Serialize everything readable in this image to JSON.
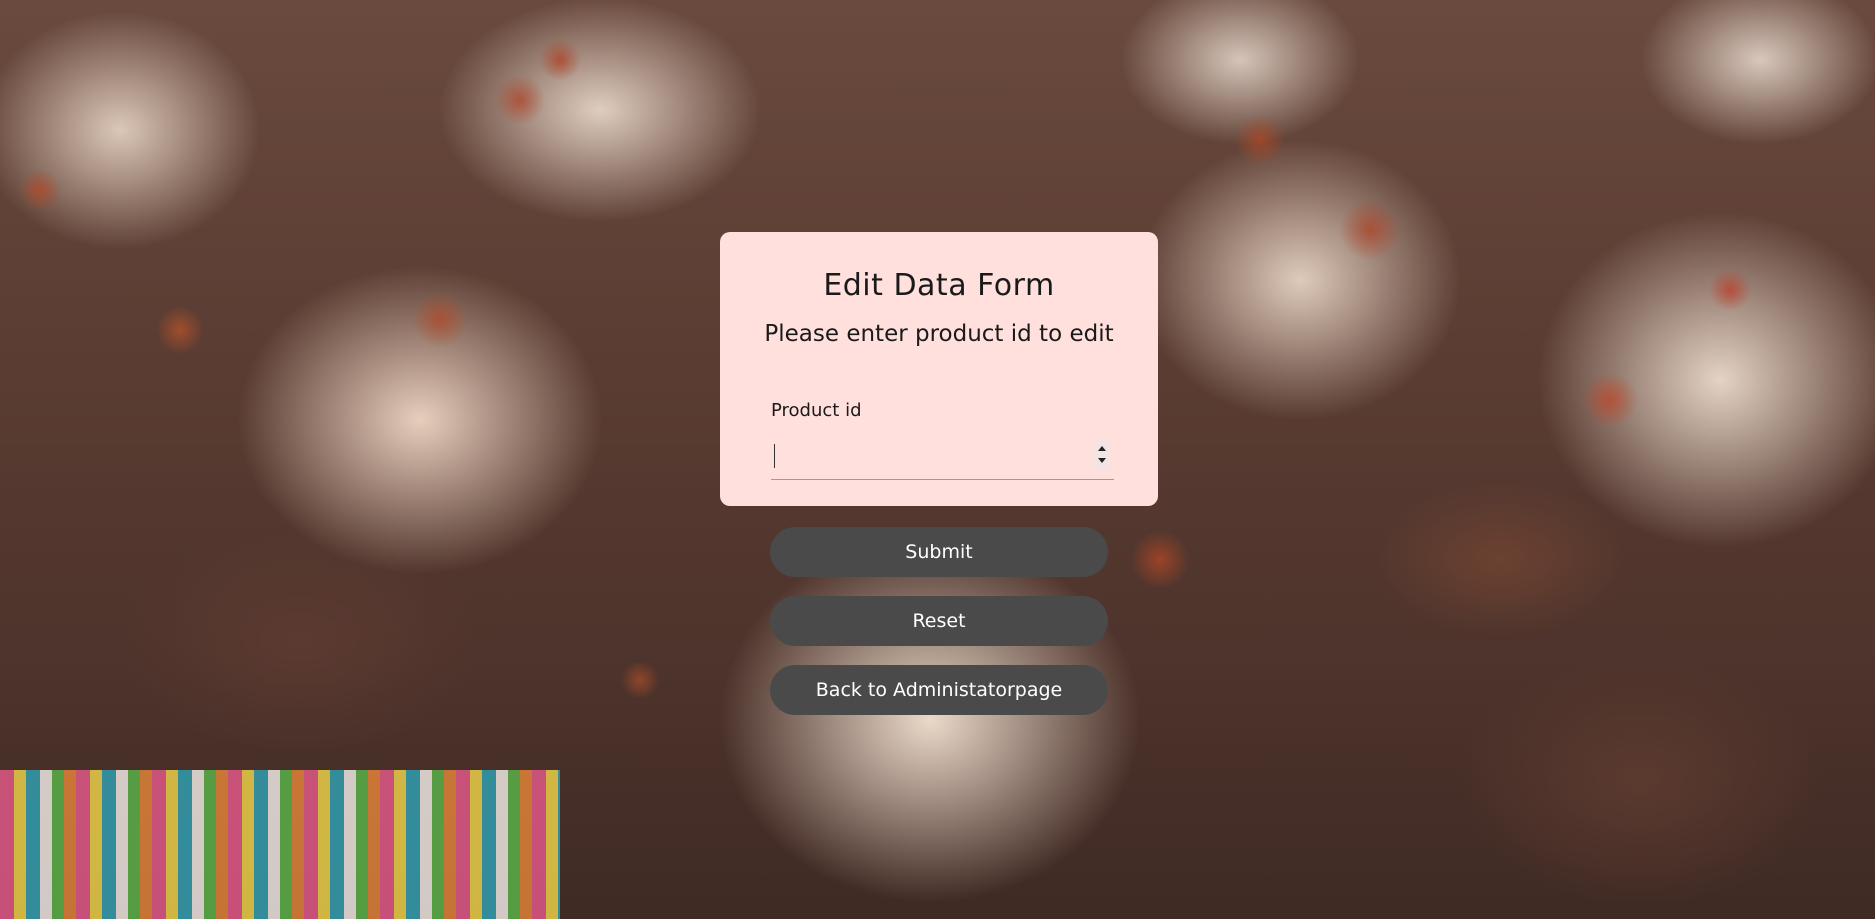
{
  "background": {
    "description_icon": "cupcakes-photo"
  },
  "form": {
    "title": "Edit Data Form",
    "subtitle": "Please enter product id to edit",
    "field_label": "Product id",
    "field_value": "",
    "field_placeholder": ""
  },
  "buttons": {
    "submit": "Submit",
    "reset": "Reset",
    "back": "Back to Administatorpage"
  },
  "colors": {
    "card_background": "#ffe0dd",
    "button_background": "#4a4a4a",
    "button_text": "#ffffff",
    "input_underline": "#c88a86"
  }
}
